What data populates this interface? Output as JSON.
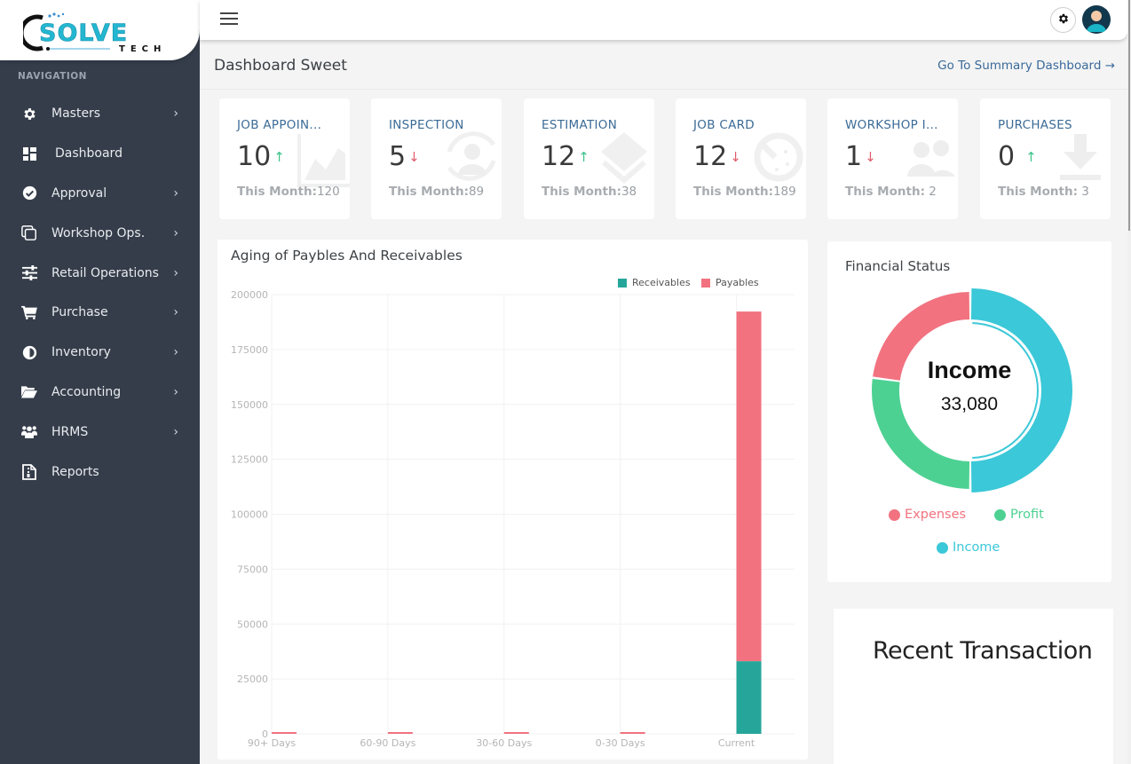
{
  "app": {
    "logo_text": "SOLVE",
    "logo_subtext": "TECH"
  },
  "sidebar": {
    "heading": "NAVIGATION",
    "items": [
      {
        "label": "Masters",
        "icon": "gear-icon",
        "has_submenu": true
      },
      {
        "label": "Dashboard",
        "icon": "dashboard-icon",
        "has_submenu": false
      },
      {
        "label": "Approval",
        "icon": "check-circle-icon",
        "has_submenu": true
      },
      {
        "label": "Workshop Ops.",
        "icon": "copy-icon",
        "has_submenu": true
      },
      {
        "label": "Retail Operations",
        "icon": "sliders-icon",
        "has_submenu": true
      },
      {
        "label": "Purchase",
        "icon": "cart-icon",
        "has_submenu": true
      },
      {
        "label": "Inventory",
        "icon": "half-circle-icon",
        "has_submenu": true
      },
      {
        "label": "Accounting",
        "icon": "folder-open-icon",
        "has_submenu": true
      },
      {
        "label": "HRMS",
        "icon": "users-icon",
        "has_submenu": true
      },
      {
        "label": "Reports",
        "icon": "report-file-icon",
        "has_submenu": false
      }
    ],
    "chevron": "›"
  },
  "header": {
    "title": "Dashboard Sweet",
    "summary_link": "Go To Summary Dashboard →"
  },
  "stats": [
    {
      "title": "JOB APPOIN...",
      "value": "10",
      "trend": "up",
      "arrow": "↑",
      "month_label": "This Month:",
      "month_value": "120",
      "icon": "chart-area-icon"
    },
    {
      "title": "INSPECTION",
      "value": "5",
      "trend": "down",
      "arrow": "↓",
      "month_label": "This Month:",
      "month_value": "89",
      "icon": "user-sync-icon"
    },
    {
      "title": "ESTIMATION",
      "value": "12",
      "trend": "up",
      "arrow": "↑",
      "month_label": "This Month:",
      "month_value": "38",
      "icon": "layers-icon"
    },
    {
      "title": "JOB CARD",
      "value": "12",
      "trend": "down",
      "arrow": "↓",
      "month_label": "This Month:",
      "month_value": "189",
      "icon": "stopwatch-icon"
    },
    {
      "title": "WORKSHOP I...",
      "value": "1",
      "trend": "down",
      "arrow": "↓",
      "month_label": "This Month:",
      "month_value": " 2",
      "icon": "users-icon"
    },
    {
      "title": "PURCHASES",
      "value": "0",
      "trend": "up",
      "arrow": "↑",
      "month_label": "This Month:",
      "month_value": " 3",
      "icon": "download-icon"
    }
  ],
  "colors": {
    "receivables": "#26a69a",
    "payables": "#f2727f",
    "expenses": "#f2727f",
    "profit": "#4dd193",
    "income": "#3bc8d8",
    "trend_up": "#3cc48c",
    "trend_down": "#e05c6c"
  },
  "financial_status": {
    "title": "Financial Status",
    "center_label": "Income",
    "center_value": "33,080",
    "legend": [
      "Expenses",
      "Profit",
      "Income"
    ]
  },
  "recent_transaction": {
    "title": "Recent Transaction"
  },
  "chart_data": [
    {
      "type": "bar",
      "stacked": true,
      "title": "Aging of Paybles And Receivables",
      "categories": [
        "90+ Days",
        "60-90 Days",
        "30-60 Days",
        "0-30 Days",
        "Current"
      ],
      "series": [
        {
          "name": "Receivables",
          "values": [
            0,
            0,
            0,
            0,
            33080
          ]
        },
        {
          "name": "Payables",
          "values": [
            800,
            800,
            800,
            800,
            159200
          ]
        }
      ],
      "xlabel": "",
      "ylabel": "",
      "ylim": [
        0,
        200000
      ],
      "yticks": [
        "0",
        "25000",
        "50000",
        "75000",
        "100000",
        "125000",
        "150000",
        "175000",
        "200000"
      ],
      "grid": true,
      "legend": "top-right"
    },
    {
      "type": "pie",
      "donut": true,
      "title": "Financial Status",
      "labels": [
        "Income",
        "Profit",
        "Expenses"
      ],
      "values": [
        33080,
        17900,
        15180
      ],
      "legend": "bottom"
    }
  ]
}
